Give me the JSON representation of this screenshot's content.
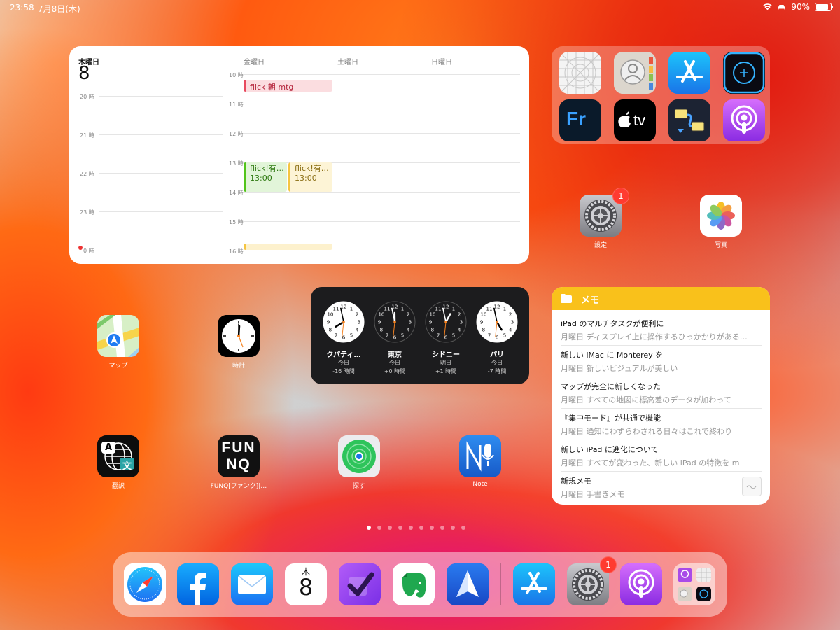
{
  "status_bar": {
    "time": "23:58",
    "date": "7月8日(木)",
    "battery": "90%"
  },
  "calendar": {
    "today_label": "木曜日",
    "today_num": "8",
    "columns": [
      "金曜日",
      "土曜日",
      "日曜日"
    ],
    "today_hours": [
      "20 時",
      "21 時",
      "22 時",
      "23 時",
      "0 時"
    ],
    "hours": [
      "10 時",
      "11 時",
      "12 時",
      "13 時",
      "14 時",
      "15 時",
      "16 時"
    ],
    "events": [
      {
        "title": "flick 朝 mtg",
        "time": ""
      },
      {
        "title": "flick!有…",
        "time": "13:00"
      },
      {
        "title": "flick!有…",
        "time": "13:00"
      }
    ]
  },
  "apps": {
    "settings": "設定",
    "photos": "写真",
    "maps": "マップ",
    "clock": "時計",
    "translate": "翻訳",
    "funq": "FUNQ[ファンク]|…",
    "findmy": "探す",
    "note": "Note",
    "settings_badge": "1",
    "dock_settings_badge": "1"
  },
  "icon_text": {
    "fresco": "Fr",
    "tv": "tv",
    "funq_top": "FUN",
    "funq_bottom": "NQ",
    "translate_a": "A",
    "translate_b": "文",
    "cal_weekday": "木",
    "cal_day": "8"
  },
  "world_clock": [
    {
      "city": "クパティ…",
      "day": "今日",
      "offset": "-16 時間",
      "h": 7.97,
      "m": 58
    },
    {
      "city": "東京",
      "day": "今日",
      "offset": "+0 時間",
      "h": 11.97,
      "m": 58
    },
    {
      "city": "シドニー",
      "day": "明日",
      "offset": "+1 時間",
      "h": 0.97,
      "m": 58
    },
    {
      "city": "パリ",
      "day": "今日",
      "offset": "-7 時間",
      "h": 4.97,
      "m": 58
    }
  ],
  "notes": {
    "header": "メモ",
    "items": [
      {
        "title": "iPad のマルチタスクが便利に",
        "sub": "月曜日  ディスプレイ上に操作するひっかかりがある…"
      },
      {
        "title": "新しい iMac に Monterey を",
        "sub": "月曜日  新しいビジュアルが美しい"
      },
      {
        "title": "マップが完全に新しくなった",
        "sub": "月曜日  すべての地図に標高差のデータが加わって"
      },
      {
        "title": "『集中モード』が共通で機能",
        "sub": "月曜日  通知にわずらわされる日々はこれで終わり"
      },
      {
        "title": "新しい iPad に進化について",
        "sub": "月曜日  すべてが変わった、新しい iPad の特徴を m"
      },
      {
        "title": "新規メモ",
        "sub": "月曜日  手書きメモ"
      }
    ]
  },
  "colors": {
    "notes_yellow": "#f9c11b",
    "badge_red": "#ff3b30",
    "event_red": "#e84a5f",
    "event_green": "#52c41a",
    "event_yellow": "#f5c542"
  }
}
